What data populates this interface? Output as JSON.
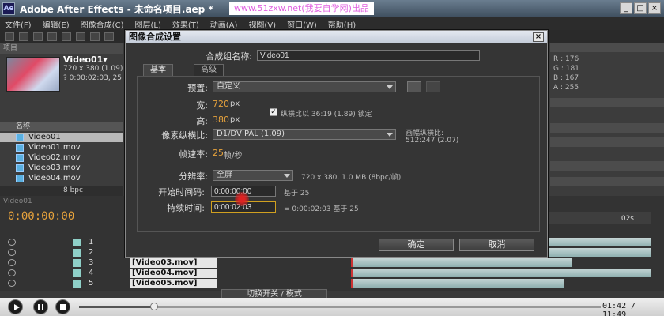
{
  "window": {
    "title": "Adobe After Effects - 未命名项目.aep *",
    "watermark": "www.51zxw.net(我要自学网)出品",
    "logo": "Ae",
    "min_glyph": "_",
    "max_glyph": "□",
    "close_glyph": "×"
  },
  "menu": [
    "文件(F)",
    "编辑(E)",
    "图像合成(C)",
    "图层(L)",
    "效果(T)",
    "动画(A)",
    "视图(V)",
    "窗口(W)",
    "帮助(H)"
  ],
  "project": {
    "tab": "项目",
    "comp_name": "Video01▾",
    "info_line1": "720 x 380 (1.09)",
    "info_line2": "? 0:00:02:03, 25",
    "list_header": "名称",
    "items": [
      "Video01",
      "Video01.mov",
      "Video02.mov",
      "Video03.mov",
      "Video04.mov"
    ],
    "footer_bpc": "8 bpc"
  },
  "right_panel": {
    "r_label": "R : 176",
    "g_label": "G : 181",
    "b_label": "B : 167",
    "a_label": "A : 255"
  },
  "timeline": {
    "tab": "Video01",
    "timecode": "0:00:00:00",
    "ruler_label": "02s",
    "switch_mode": "切换开关 / 模式",
    "layers": [
      {
        "num": "1",
        "name": ""
      },
      {
        "num": "2",
        "name": ""
      },
      {
        "num": "3",
        "name": "[Video03.mov]"
      },
      {
        "num": "4",
        "name": "[Video04.mov]"
      },
      {
        "num": "5",
        "name": "[Video05.mov]"
      }
    ]
  },
  "dialog": {
    "title": "图像合成设置",
    "close_glyph": "×",
    "comp_name_label": "合成组名称:",
    "comp_name_value": "Video01",
    "tab_basic": "基本",
    "tab_advanced": "高级",
    "preset_label": "预置:",
    "preset_value": "自定义",
    "width_label": "宽:",
    "width_value": "720",
    "width_unit": "px",
    "height_label": "高:",
    "height_value": "380",
    "height_unit": "px",
    "lock_text": "纵横比以 36:19 (1.89) 锁定",
    "lock_checked": "✓",
    "par_label": "像素纵横比:",
    "par_value": "D1/DV PAL (1.09)",
    "frame_ratio_label": "画幅纵横比:",
    "frame_ratio_value": "512:247 (2.07)",
    "fps_label": "帧速率:",
    "fps_value": "25",
    "fps_unit": "帧/秒",
    "resolution_label": "分辨率:",
    "resolution_value": "全屏",
    "resolution_info": "720 x 380, 1.0 MB (8bpc/帧)",
    "start_tc_label": "开始时间码:",
    "start_tc_value": "0:00:00:00",
    "start_tc_base": "基于 25",
    "duration_label": "持续时间:",
    "duration_value": "0:00:02:03",
    "duration_info": "= 0:00:02:03 基于 25",
    "ok_label": "确定",
    "cancel_label": "取消"
  },
  "player": {
    "time": "01:42 / 11:49",
    "progress": 0.144
  }
}
